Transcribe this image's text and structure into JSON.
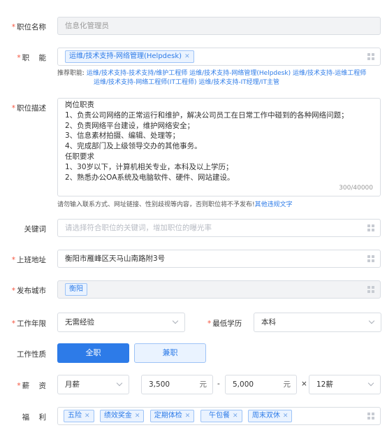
{
  "job_title": {
    "label": "职位名称",
    "value": "信息化管理员"
  },
  "function": {
    "label": "职    能",
    "tag": "运维/技术支持-网络管理(Helpdesk)",
    "recommend_label": "推荐职能:",
    "recommend_line1": [
      "运维/技术支持-技术支持/维护工程师",
      "运维/技术支持-网络管理(Helpdesk)",
      "运维/技术支持-运维工程师"
    ],
    "recommend_line2": [
      "运维/技术支持-网络工程师(IT工程师)",
      "运维/技术支持-IT经理/IT主管"
    ]
  },
  "description": {
    "label": "职位描述",
    "lines": [
      "岗位职责",
      "1、负责公司网络的正常运行和维护，解决公司员工在日常工作中碰到的各种网络问题；",
      "2、负责网络平台建设，维护网络安全；",
      "3、信息素材拍摄、编辑、处理等；",
      "4、完成部门及上级领导交办的其他事务。",
      "任职要求",
      "1、30岁以下，计算机相关专业，本科及以上学历；",
      "2、熟悉办公OA系统及电脑软件、硬件、网站建设。"
    ],
    "count": "300/40000",
    "warning": "请勿输入联系方式、网址链接、性别歧视等内容，否则职位将不予发布!",
    "warning_link": "其他违规文字"
  },
  "keywords": {
    "label": "关键词",
    "placeholder": "请选择符合职位的关键词，增加职位的曝光率"
  },
  "address": {
    "label": "上班地址",
    "value": "衡阳市雁峰区天马山南路附3号"
  },
  "city": {
    "label": "发布城市",
    "tag": "衡阳"
  },
  "experience": {
    "label": "工作年限",
    "value": "无需经验"
  },
  "education": {
    "label": "最低学历",
    "value": "本科"
  },
  "nature": {
    "label": "工作性质",
    "option1": "全职",
    "option2": "兼职"
  },
  "salary": {
    "label": "薪    资",
    "type": "月薪",
    "min": "3,500",
    "max": "5,000",
    "unit": "元",
    "dash": "-",
    "times": "×",
    "months": "12薪"
  },
  "benefits": {
    "label": "福    利",
    "tags": [
      "五险",
      "绩效奖金",
      "定期体检",
      "  午包餐",
      "周末双休"
    ]
  },
  "colors": {
    "accent": "#2d7be8",
    "required": "#f5533d"
  }
}
